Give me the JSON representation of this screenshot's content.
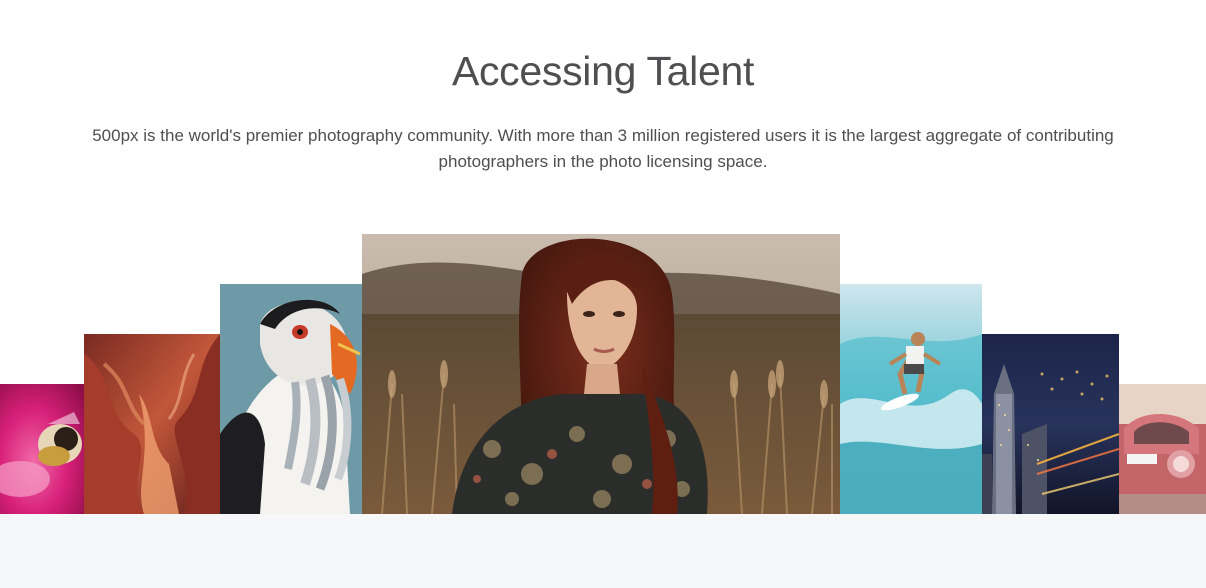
{
  "section": {
    "title": "Accessing Talent",
    "description": "500px is the world's premier photography community. With more than 3 million registered users it is the largest aggregate of contributing photographers in the photo licensing space."
  },
  "gallery": {
    "photos": [
      {
        "subject": "bee-on-pink-flower"
      },
      {
        "subject": "slot-canyon"
      },
      {
        "subject": "puffin-with-fish"
      },
      {
        "subject": "woman-in-wheat-field"
      },
      {
        "subject": "surfer-on-wave"
      },
      {
        "subject": "city-at-night"
      },
      {
        "subject": "red-vintage-car"
      }
    ]
  },
  "colors": {
    "text": "#4f4f52",
    "background": "#ffffff",
    "footer_band": "#f6f7f9"
  }
}
